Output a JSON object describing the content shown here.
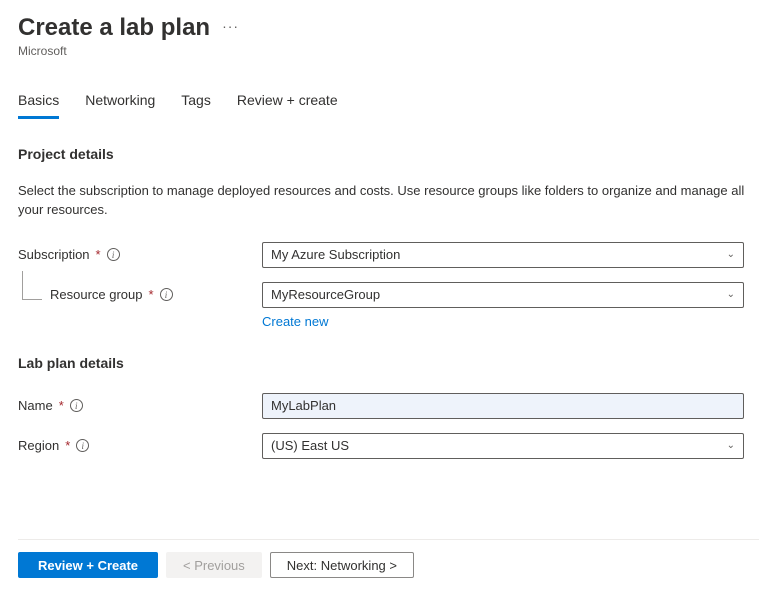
{
  "header": {
    "title": "Create a lab plan",
    "subtitle": "Microsoft"
  },
  "tabs": {
    "basics": "Basics",
    "networking": "Networking",
    "tags": "Tags",
    "review": "Review + create"
  },
  "sections": {
    "project_details": {
      "title": "Project details",
      "description": "Select the subscription to manage deployed resources and costs. Use resource groups like folders to organize and manage all your resources."
    },
    "lab_plan_details": {
      "title": "Lab plan details"
    }
  },
  "fields": {
    "subscription": {
      "label": "Subscription",
      "value": "My Azure Subscription"
    },
    "resource_group": {
      "label": "Resource group",
      "value": "MyResourceGroup",
      "create_new": "Create new"
    },
    "name": {
      "label": "Name",
      "value": "MyLabPlan"
    },
    "region": {
      "label": "Region",
      "value": "(US) East US"
    }
  },
  "footer": {
    "review": "Review + Create",
    "previous": "< Previous",
    "next": "Next: Networking >"
  }
}
